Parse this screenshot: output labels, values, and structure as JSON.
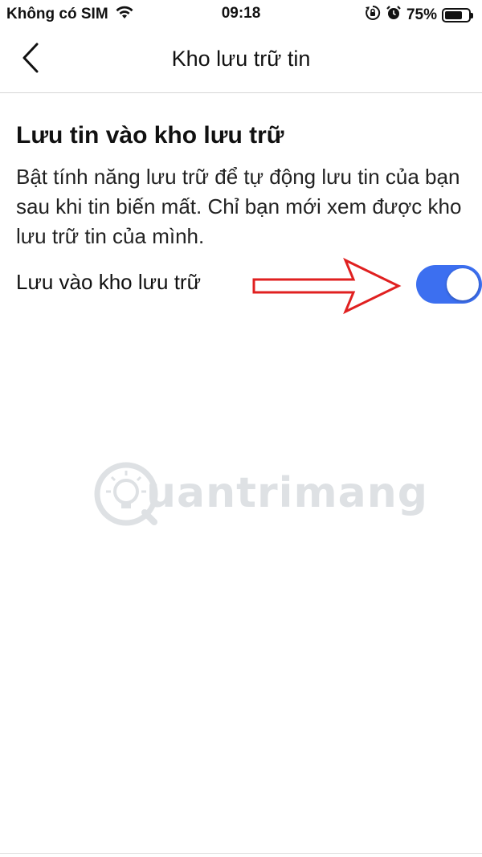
{
  "status_bar": {
    "carrier": "Không có SIM",
    "time": "09:18",
    "battery_percent": "75%",
    "battery_level": 0.75,
    "icons": [
      "wifi-icon",
      "screen-rotation-lock-icon",
      "alarm-icon",
      "battery-icon"
    ]
  },
  "header": {
    "title": "Kho lưu trữ tin",
    "back_icon": "chevron-left-icon"
  },
  "section": {
    "title": "Lưu tin vào kho lưu trữ",
    "description": "Bật tính năng lưu trữ để tự động lưu tin của bạn sau khi tin biến mất. Chỉ bạn mới xem được kho lưu trữ tin của mình."
  },
  "setting": {
    "label": "Lưu vào kho lưu trữ",
    "enabled": true,
    "toggle_color": "#3c6ff0"
  },
  "annotation": {
    "arrow_color": "#e02020"
  },
  "watermark": {
    "text": "uantrimang"
  }
}
